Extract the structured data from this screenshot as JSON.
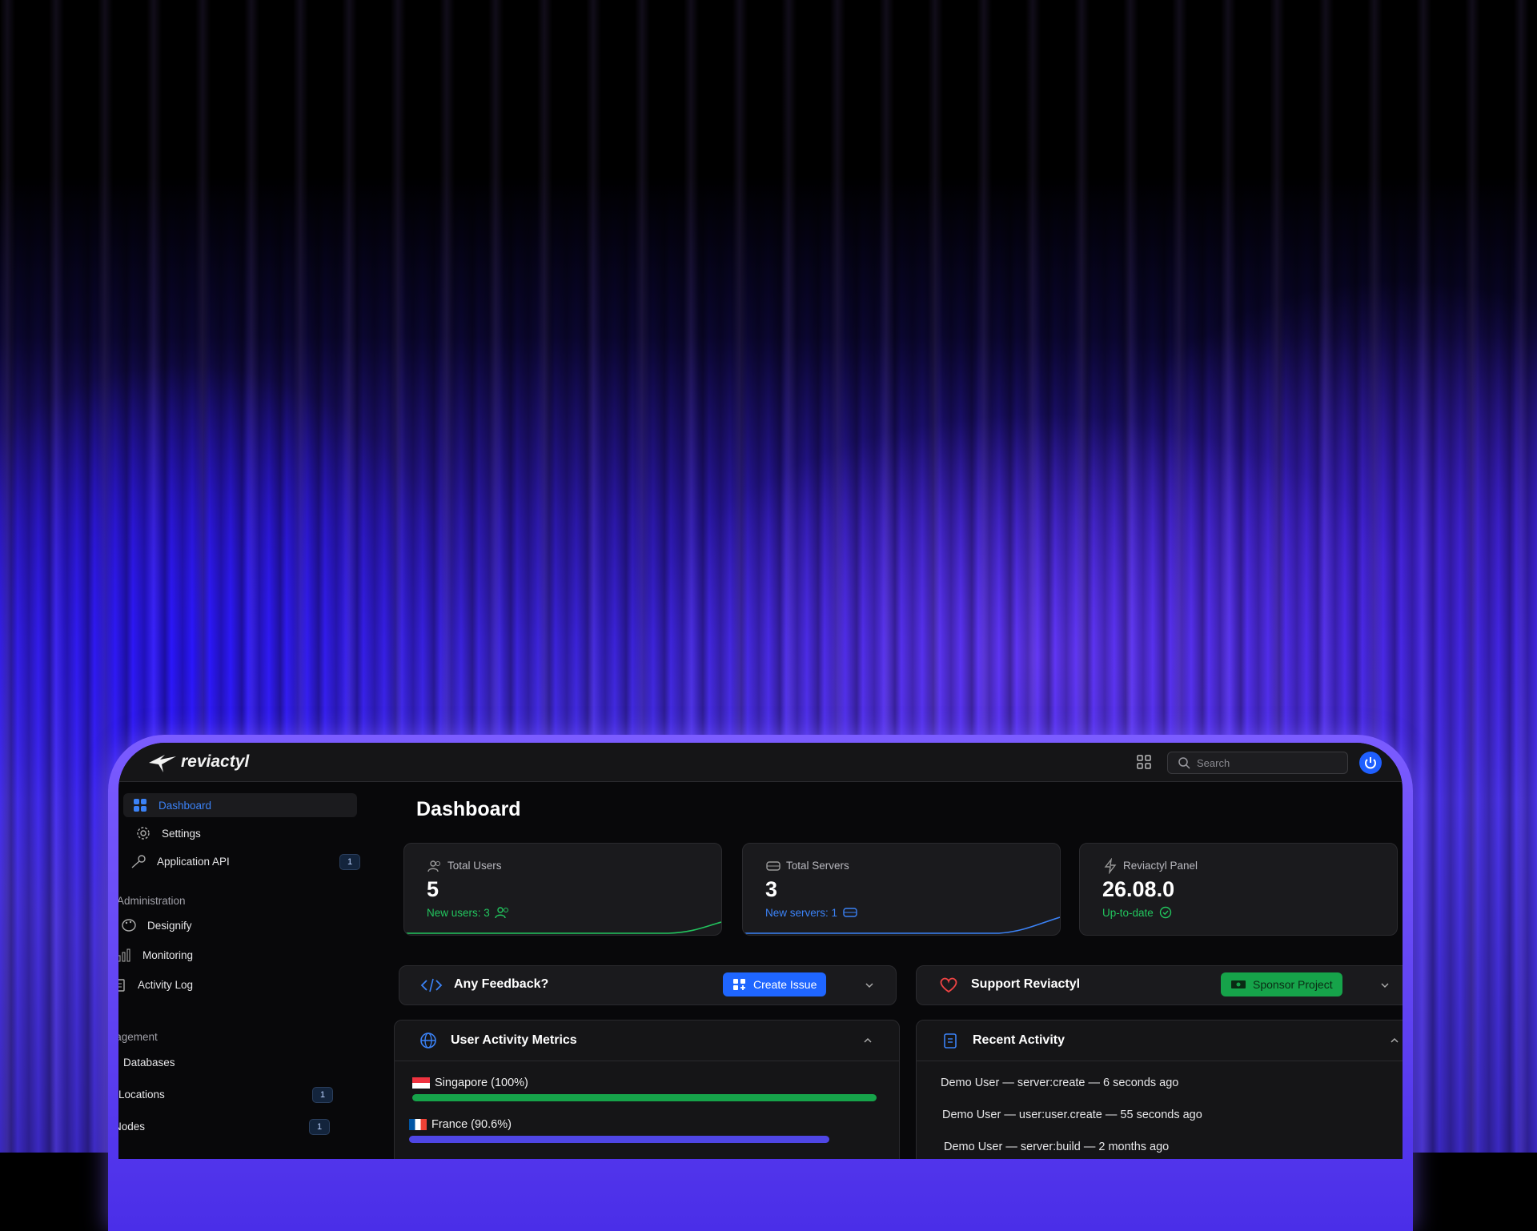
{
  "app": {
    "name": "reviactyl"
  },
  "header": {
    "search_placeholder": "Search"
  },
  "sidebar": {
    "items": [
      {
        "label": "Dashboard",
        "active": true
      },
      {
        "label": "Settings"
      },
      {
        "label": "Application API",
        "badge": "1"
      }
    ],
    "administration": {
      "label": "Administration",
      "items": [
        {
          "label": "Designify"
        },
        {
          "label": "Monitoring"
        },
        {
          "label": "Activity Log"
        }
      ]
    },
    "management": {
      "label": "Management",
      "items": [
        {
          "label": "Databases"
        },
        {
          "label": "Locations",
          "badge": "1"
        },
        {
          "label": "Nodes",
          "badge": "1"
        }
      ]
    }
  },
  "main": {
    "title": "Dashboard",
    "stats": [
      {
        "label": "Total Users",
        "value": "5",
        "sub": "New users: 3",
        "color": "#22c55e"
      },
      {
        "label": "Total Servers",
        "value": "3",
        "sub": "New servers: 1",
        "color": "#3b82f6"
      },
      {
        "label": "Reviactyl Panel",
        "value": "26.08.0",
        "sub": "Up-to-date",
        "color": "#22c55e"
      }
    ],
    "feedback": {
      "title": "Any Feedback?",
      "button": "Create Issue"
    },
    "support": {
      "title": "Support Reviactyl",
      "button": "Sponsor Project"
    },
    "metrics": {
      "title": "User Activity Metrics",
      "countries": [
        {
          "label": "Singapore (100%)",
          "percent": 100,
          "color": "#16a34a"
        },
        {
          "label": "France (90.6%)",
          "percent": 90.6,
          "color": "#4f46e5"
        }
      ]
    },
    "recent": {
      "title": "Recent Activity",
      "entries": [
        "Demo User — server:create — 6 seconds ago",
        "Demo User — user:user.create — 55 seconds ago",
        "Demo User — server:build — 2 months ago"
      ]
    }
  },
  "colors": {
    "accent": "#1f66ff",
    "success": "#16a34a",
    "background": "#08080a"
  }
}
